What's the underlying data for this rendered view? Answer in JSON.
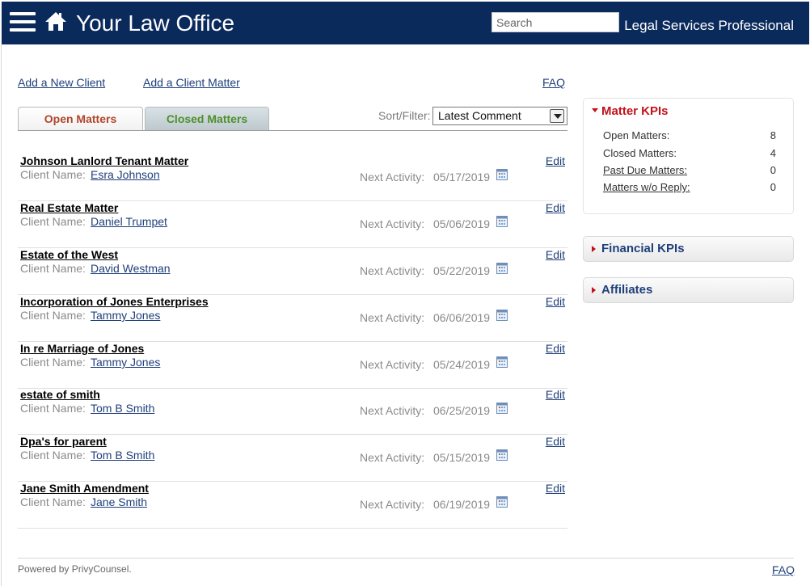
{
  "header": {
    "title": "Your Law Office",
    "search_placeholder": "Search",
    "user_role": "Legal Services Professional",
    "menu_icon": "hamburger-menu-icon",
    "home_icon": "home-icon",
    "bg_color": "#0b2a5c"
  },
  "links": {
    "add_client": "Add a New Client",
    "add_matter": "Add a Client Matter",
    "faq": "FAQ"
  },
  "tabs": [
    {
      "label": "Open Matters",
      "active": true
    },
    {
      "label": "Closed Matters",
      "active": false
    }
  ],
  "sort": {
    "label": "Sort/Filter:",
    "selected": "Latest Comment"
  },
  "matters": [
    {
      "title": "Johnson Lanlord Tenant Matter",
      "client_label": "Client Name:",
      "client": "Esra Johnson",
      "next_label": "Next Activity:",
      "next_date": "05/17/2019",
      "edit": "Edit"
    },
    {
      "title": "Real Estate Matter",
      "client_label": "Client Name:",
      "client": "Daniel Trumpet",
      "next_label": "Next Activity:",
      "next_date": "05/06/2019",
      "edit": "Edit"
    },
    {
      "title": "Estate of the West",
      "client_label": "Client Name:",
      "client": "David Westman",
      "next_label": "Next Activity:",
      "next_date": "05/22/2019",
      "edit": "Edit"
    },
    {
      "title": "Incorporation of Jones Enterprises",
      "client_label": "Client Name:",
      "client": "Tammy Jones",
      "next_label": "Next Activity:",
      "next_date": "06/06/2019",
      "edit": "Edit"
    },
    {
      "title": "In re Marriage of Jones",
      "client_label": "Client Name:",
      "client": "Tammy Jones",
      "next_label": "Next Activity:",
      "next_date": "05/24/2019",
      "edit": "Edit"
    },
    {
      "title": "estate of smith",
      "client_label": "Client Name:",
      "client": "Tom B Smith",
      "next_label": "Next Activity:",
      "next_date": "06/25/2019",
      "edit": "Edit"
    },
    {
      "title": "Dpa's for parent",
      "client_label": "Client Name:",
      "client": "Tom B Smith",
      "next_label": "Next Activity:",
      "next_date": "05/15/2019",
      "edit": "Edit"
    },
    {
      "title": "Jane Smith Amendment",
      "client_label": "Client Name:",
      "client": "Jane Smith",
      "next_label": "Next Activity:",
      "next_date": "06/19/2019",
      "edit": "Edit"
    }
  ],
  "kpi": {
    "title": "Matter KPIs",
    "rows": [
      {
        "label": "Open Matters:",
        "value": "8",
        "link": false
      },
      {
        "label": "Closed Matters:",
        "value": "4",
        "link": false
      },
      {
        "label": "Past Due Matters:",
        "value": "0",
        "link": true
      },
      {
        "label": "Matters w/o Reply:",
        "value": "0",
        "link": true
      }
    ]
  },
  "panels": {
    "financial": "Financial KPIs",
    "affiliates": "Affiliates"
  },
  "footer": {
    "powered": "Powered by PrivyCounsel.",
    "faq": "FAQ"
  }
}
